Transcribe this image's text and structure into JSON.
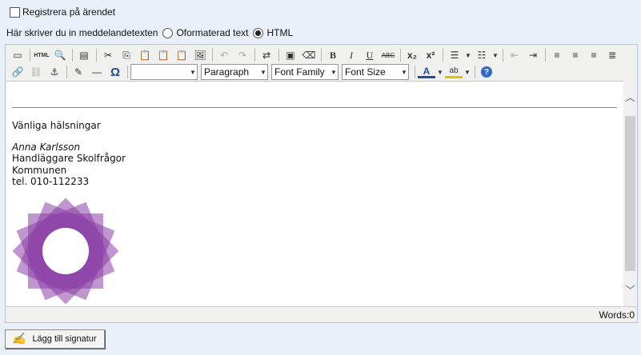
{
  "register": {
    "label": "Registrera på ärendet",
    "checked": false
  },
  "format": {
    "prompt": "Här skriver du in meddelandetexten",
    "options": [
      {
        "label": "Oformaterad text",
        "selected": false
      },
      {
        "label": "HTML",
        "selected": true
      }
    ]
  },
  "toolbar": {
    "html_label": "HTML",
    "bold": "B",
    "italic": "I",
    "underline": "U",
    "strike": "ABC",
    "subscript": "x₂",
    "superscript": "x²",
    "omega": "Ω",
    "style_select": "",
    "format_select": "Paragraph",
    "font_family_select": "Font Family",
    "font_size_select": "Font Size",
    "text_color": "A",
    "highlight": "ab",
    "help": "?"
  },
  "signature": {
    "greeting": "Vänliga hälsningar",
    "name": "Anna Karlsson",
    "title": "Handläggare Skolfrågor",
    "org": "Kommunen",
    "phone": "tel. 010-112233"
  },
  "status": {
    "words": "Words:0"
  },
  "add_signature_button": {
    "label": "Lägg till signatur"
  },
  "colors": {
    "logo": "#8a3fa6",
    "page_bg": "#e9f0fa"
  }
}
